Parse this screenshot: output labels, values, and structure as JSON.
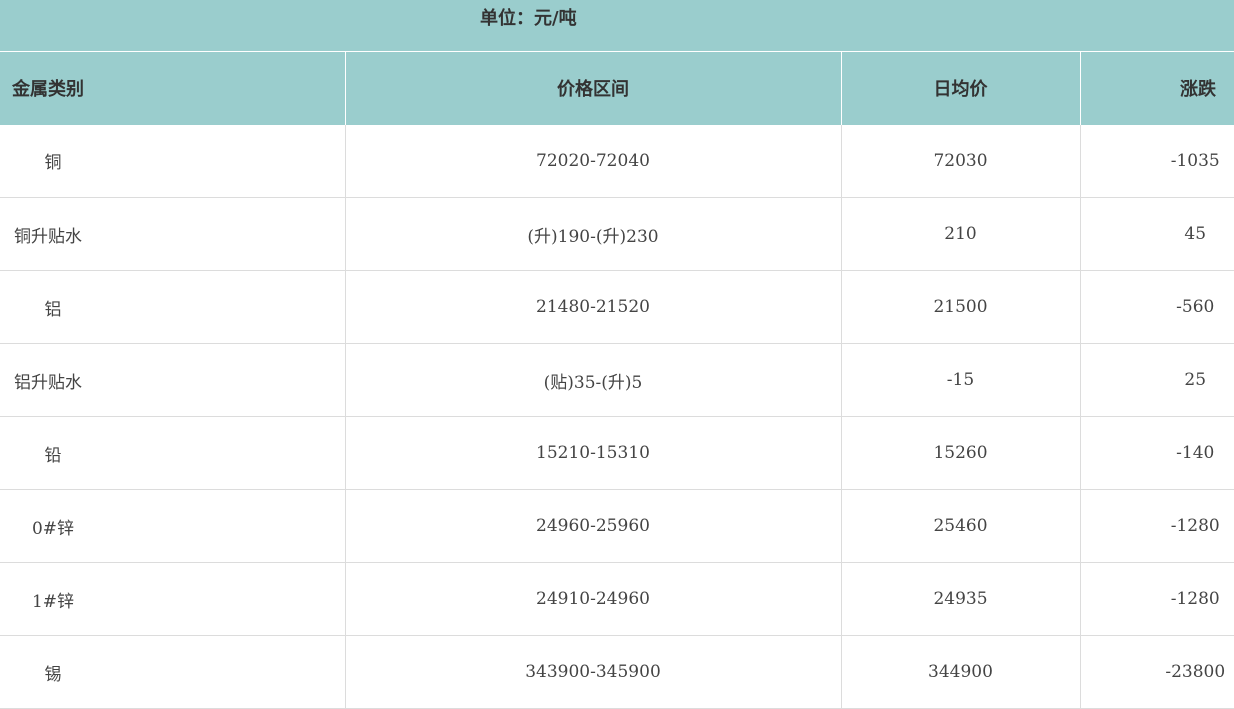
{
  "unit_label": "单位：元/吨",
  "columns": [
    "金属类别",
    "价格区间",
    "日均价",
    "涨跌"
  ],
  "rows": [
    {
      "metal": "铜",
      "range": "72020-72040",
      "avg": "72030",
      "change": "-1035"
    },
    {
      "metal": "铜升贴水",
      "range": "(升)190-(升)230",
      "avg": "210",
      "change": "45"
    },
    {
      "metal": "铝",
      "range": "21480-21520",
      "avg": "21500",
      "change": "-560"
    },
    {
      "metal": "铝升贴水",
      "range": "(贴)35-(升)5",
      "avg": "-15",
      "change": "25"
    },
    {
      "metal": "铅",
      "range": "15210-15310",
      "avg": "15260",
      "change": "-140"
    },
    {
      "metal": "0#锌",
      "range": "24960-25960",
      "avg": "25460",
      "change": "-1280"
    },
    {
      "metal": "1#锌",
      "range": "24910-24960",
      "avg": "24935",
      "change": "-1280"
    },
    {
      "metal": "锡",
      "range": "343900-345900",
      "avg": "344900",
      "change": "-23800"
    }
  ],
  "colors": {
    "header_bg": "#9acdcd",
    "text": "#333333",
    "row_border": "#dcdcdc"
  }
}
